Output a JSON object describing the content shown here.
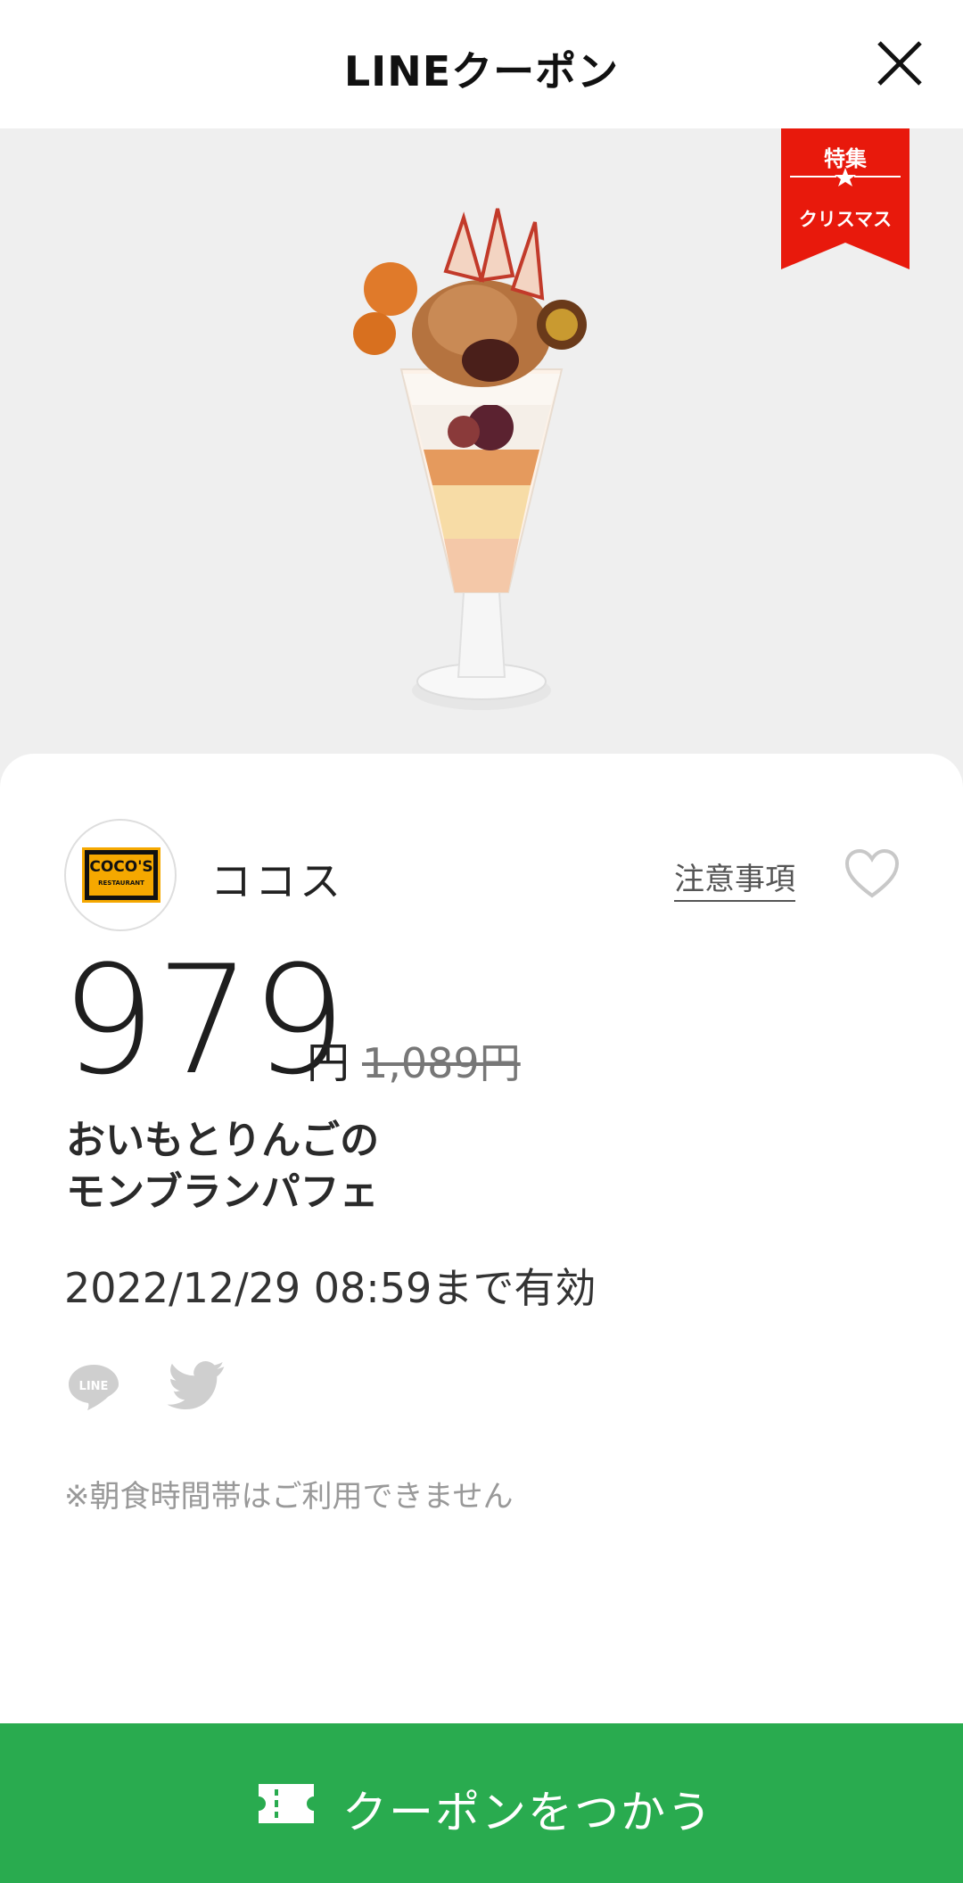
{
  "header": {
    "title": "LINEクーポン",
    "close_icon": "close-icon"
  },
  "hero": {
    "image_subject": "parfait-photo",
    "badge": {
      "top": "特集",
      "bottom": "クリスマス",
      "color": "#e8190c"
    }
  },
  "shop": {
    "name": "ココス",
    "logo_text": "COCO'S",
    "logo_sub": "RESTAURANT",
    "notes_label": "注意事項",
    "favorite_icon": "heart-icon"
  },
  "price": {
    "value": "979",
    "unit": "円",
    "original": "1,089円"
  },
  "product": {
    "name_line1": "おいもとりんごの",
    "name_line2": "モンブランパフェ"
  },
  "validity": "2022/12/29  08:59まで有効",
  "share": {
    "line_icon": "line-share-icon",
    "twitter_icon": "twitter-share-icon"
  },
  "disclaimer": "※朝食時間帯はご利用できません",
  "cta": {
    "label": "クーポンをつかう",
    "icon": "ticket-icon",
    "color": "#29ab4f"
  }
}
